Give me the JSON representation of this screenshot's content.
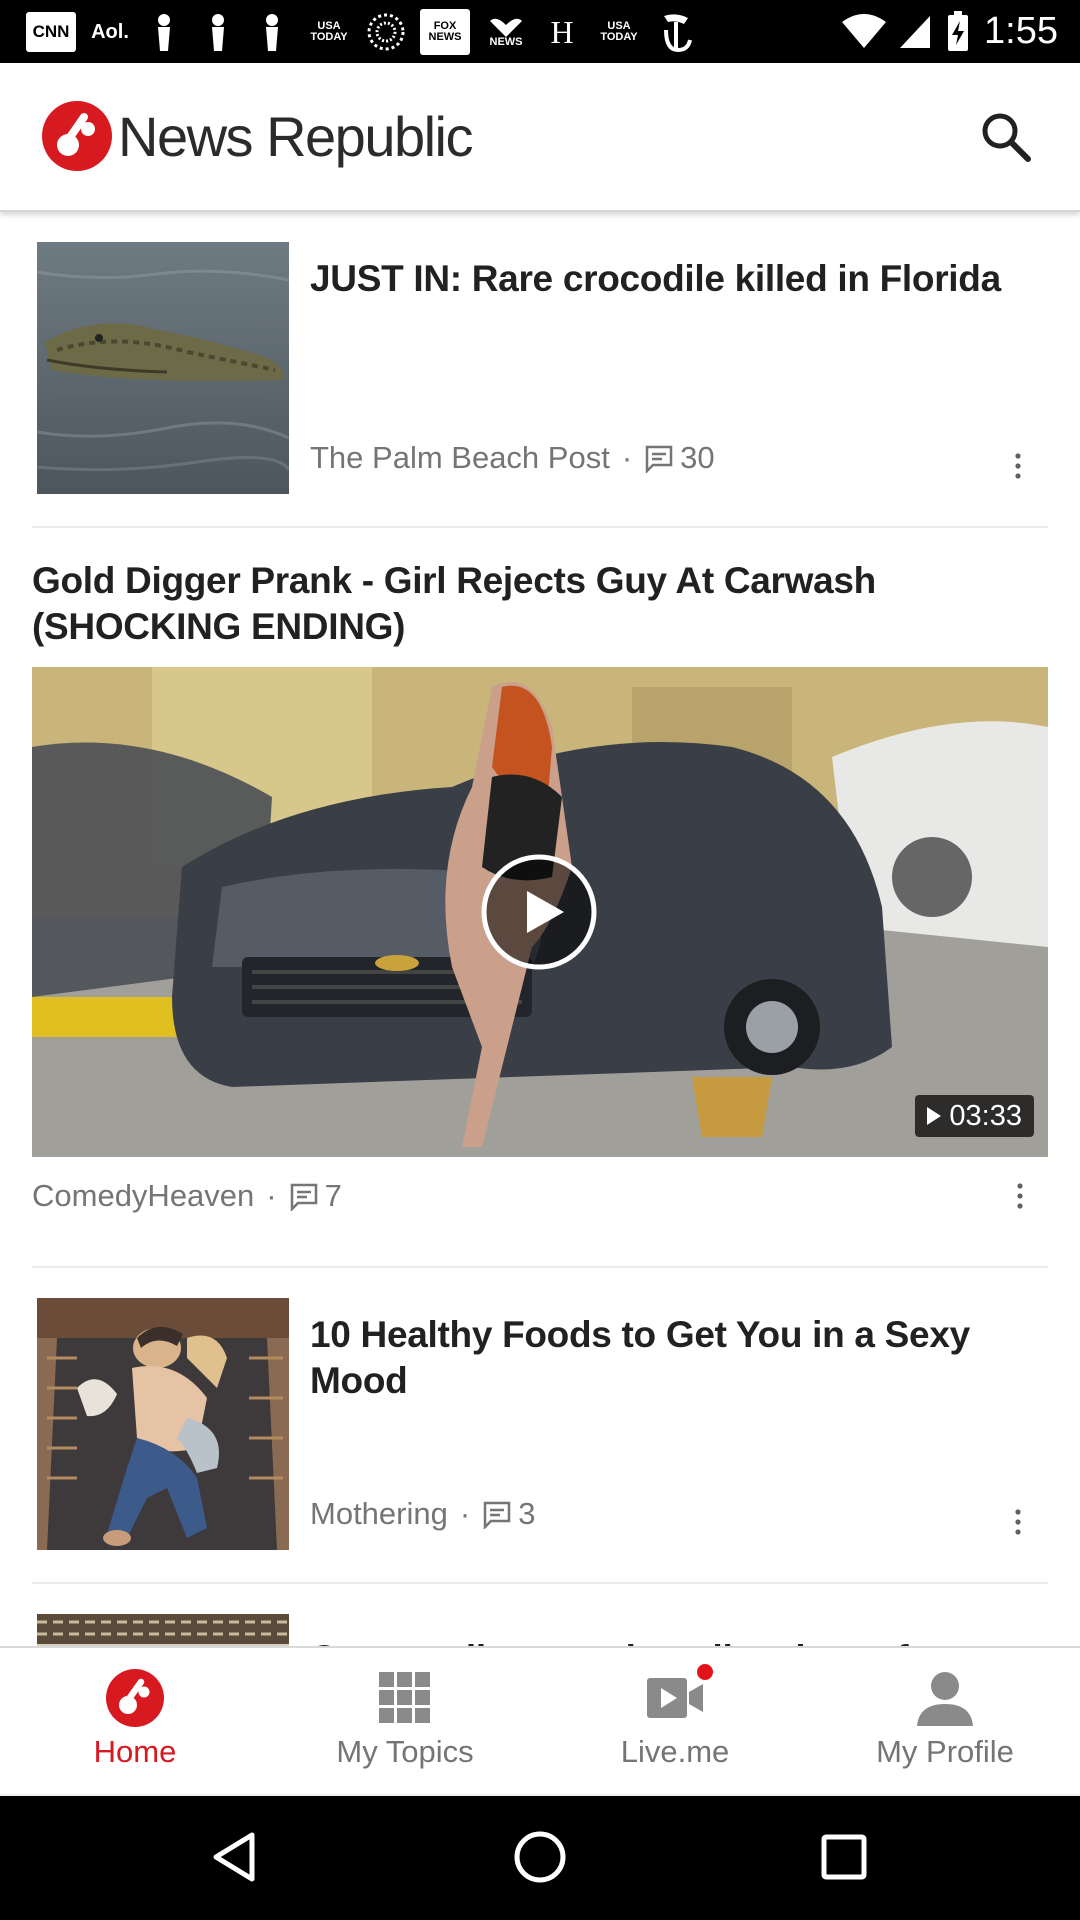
{
  "status_bar": {
    "time": "1:55",
    "notification_icons": [
      "CNN",
      "Aol.",
      "USA TODAY",
      "FOX NEWS",
      "NEWS",
      "H",
      "USA TODAY"
    ]
  },
  "app": {
    "name": "News Republic",
    "brand_color": "#d71920"
  },
  "feed": [
    {
      "type": "article",
      "headline": "JUST IN: Rare crocodile killed in Florida",
      "source": "The Palm Beach Post",
      "comments": "30"
    },
    {
      "type": "video",
      "headline": "Gold Digger Prank - Girl Rejects Guy At Carwash (SHOCKING ENDING)",
      "duration": "03:33",
      "source": "ComedyHeaven",
      "comments": "7"
    },
    {
      "type": "article",
      "headline": "10 Healthy Foods to Get You in a Sexy Mood",
      "source": "Mothering",
      "comments": "3"
    },
    {
      "type": "article",
      "headline": "Conn. college student dies days after pancake-eating contest"
    }
  ],
  "bottom_nav": [
    {
      "label": "Home",
      "icon": "home-icon",
      "active": true
    },
    {
      "label": "My Topics",
      "icon": "grid-icon",
      "active": false
    },
    {
      "label": "Live.me",
      "icon": "video-camera-icon",
      "active": false,
      "badge": true
    },
    {
      "label": "My Profile",
      "icon": "person-icon",
      "active": false
    }
  ]
}
